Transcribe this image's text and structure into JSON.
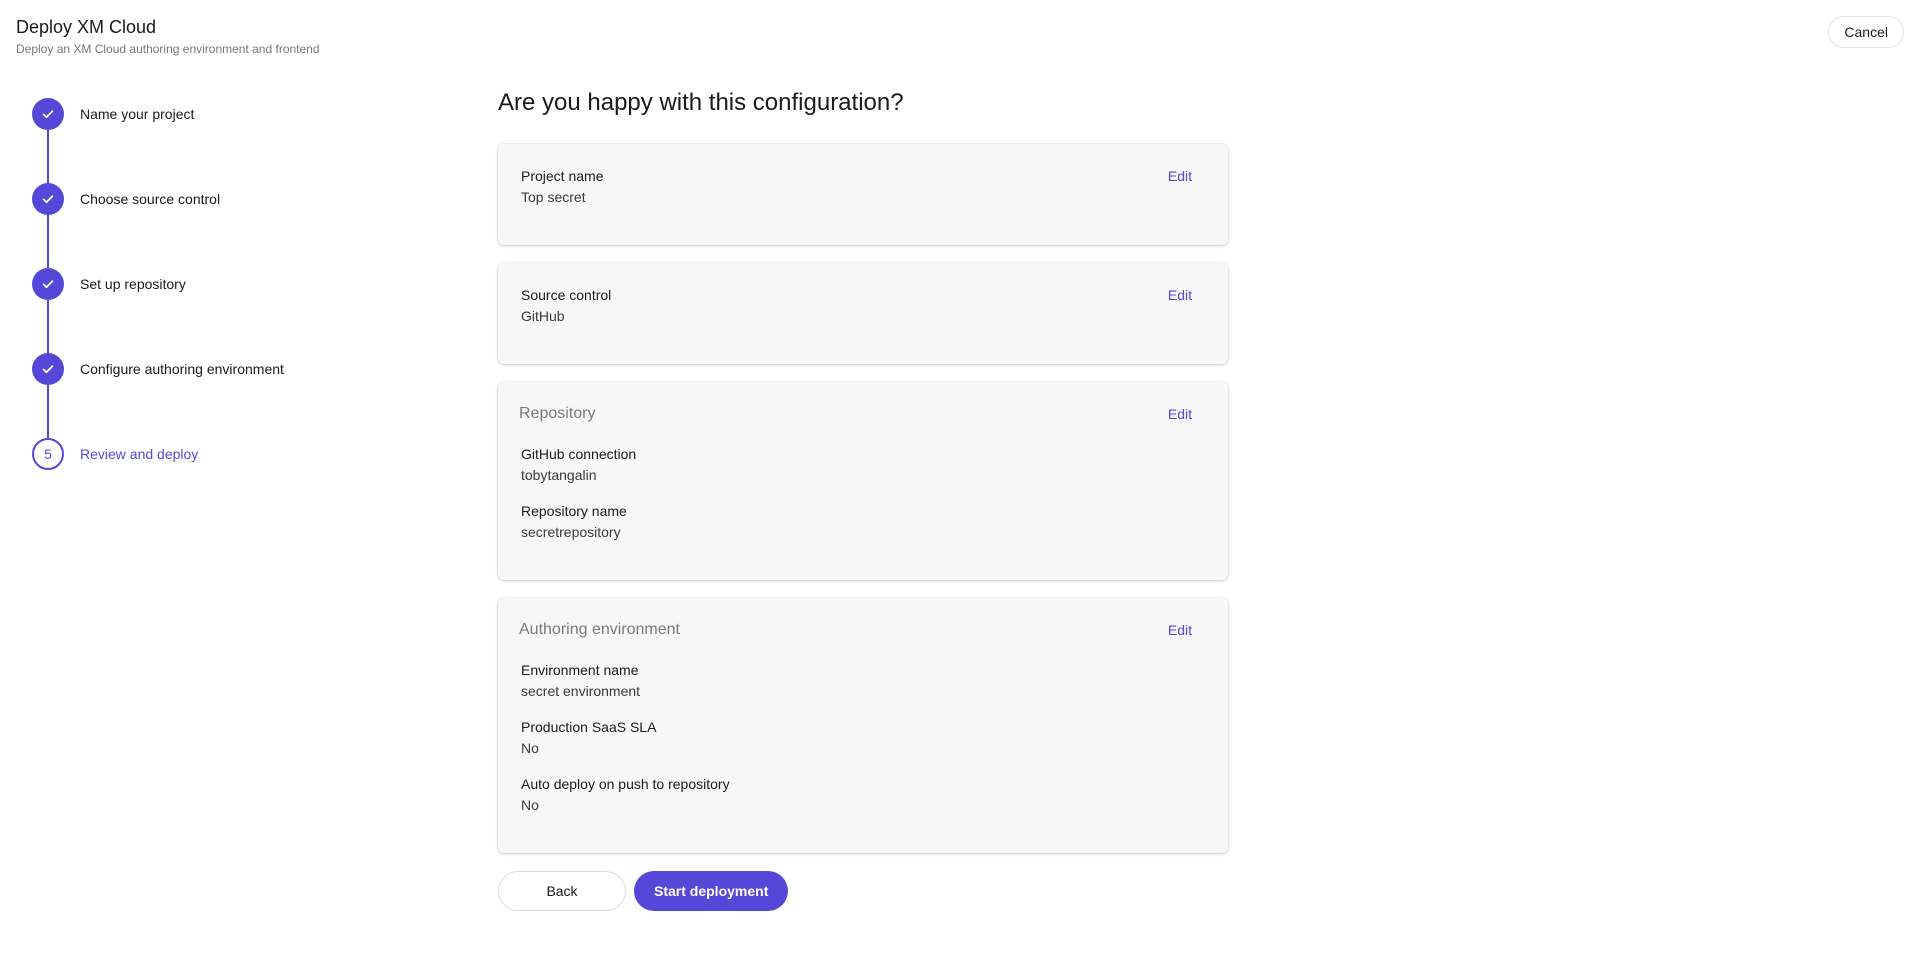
{
  "header": {
    "title": "Deploy XM Cloud",
    "subtitle": "Deploy an XM Cloud authoring environment and frontend",
    "cancel_label": "Cancel"
  },
  "steps": [
    {
      "label": "Name your project",
      "state": "complete"
    },
    {
      "label": "Choose source control",
      "state": "complete"
    },
    {
      "label": "Set up repository",
      "state": "complete"
    },
    {
      "label": "Configure authoring environment",
      "state": "complete"
    },
    {
      "label": "Review and deploy",
      "state": "current",
      "number": "5"
    }
  ],
  "main": {
    "heading": "Are you happy with this configuration?",
    "edit_label": "Edit",
    "project": {
      "label": "Project name",
      "value": "Top secret"
    },
    "source_control": {
      "label": "Source control",
      "value": "GitHub"
    },
    "repository": {
      "title": "Repository",
      "fields": [
        {
          "label": "GitHub connection",
          "value": "tobytangalin"
        },
        {
          "label": "Repository name",
          "value": "secretrepository"
        }
      ]
    },
    "authoring": {
      "title": "Authoring environment",
      "fields": [
        {
          "label": "Environment name",
          "value": "secret environment"
        },
        {
          "label": "Production SaaS SLA",
          "value": "No"
        },
        {
          "label": "Auto deploy on push to repository",
          "value": "No"
        }
      ]
    },
    "back_label": "Back",
    "start_label": "Start deployment"
  },
  "colors": {
    "accent": "#5548d9"
  }
}
